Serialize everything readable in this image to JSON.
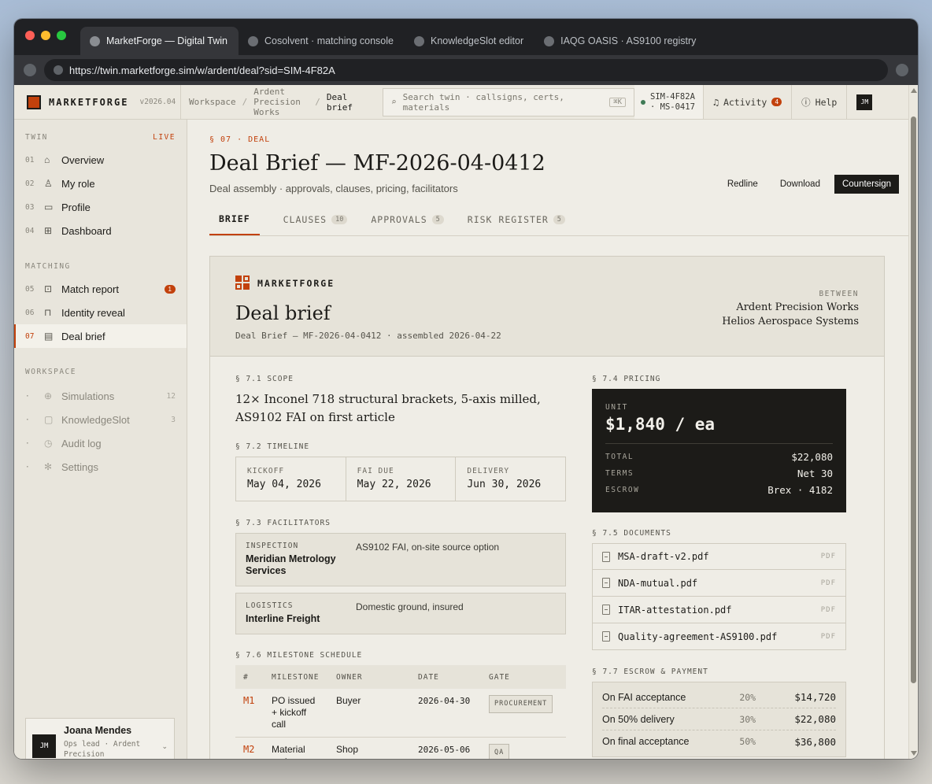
{
  "browser": {
    "tabs": [
      {
        "title": "MarketForge — Digital Twin"
      },
      {
        "title": "Cosolvent · matching console"
      },
      {
        "title": "KnowledgeSlot editor"
      },
      {
        "title": "IAQG OASIS · AS9100 registry"
      }
    ],
    "url": "https://twin.marketforge.sim/w/ardent/deal?sid=SIM-4F82A"
  },
  "header": {
    "brand": "MARKETFORGE",
    "version": "v2026.04",
    "breadcrumb": [
      "Workspace",
      "Ardent Precision Works",
      "Deal brief"
    ],
    "search_placeholder": "Search twin · callsigns, certs, materials",
    "search_shortcut": "⌘K",
    "sim_id": "SIM-4F82A · MS-0417",
    "activity_label": "Activity",
    "activity_count": "4",
    "help_label": "Help",
    "user_initials": "JM"
  },
  "sidebar": {
    "twin_section": "TWIN",
    "live_label": "LIVE",
    "twin_items": [
      {
        "num": "01",
        "label": "Overview",
        "icon": "home-icon"
      },
      {
        "num": "02",
        "label": "My role",
        "icon": "user-icon"
      },
      {
        "num": "03",
        "label": "Profile",
        "icon": "id-card-icon"
      },
      {
        "num": "04",
        "label": "Dashboard",
        "icon": "grid-icon"
      }
    ],
    "matching_section": "MATCHING",
    "matching_items": [
      {
        "num": "05",
        "label": "Match report",
        "icon": "ticket-icon",
        "badge": "1"
      },
      {
        "num": "06",
        "label": "Identity reveal",
        "icon": "lock-icon"
      },
      {
        "num": "07",
        "label": "Deal brief",
        "icon": "document-icon"
      }
    ],
    "workspace_section": "WORKSPACE",
    "workspace_items": [
      {
        "num": "·",
        "label": "Simulations",
        "icon": "globe-icon",
        "count": "12"
      },
      {
        "num": "·",
        "label": "KnowledgeSlot",
        "icon": "book-icon",
        "count": "3"
      },
      {
        "num": "·",
        "label": "Audit log",
        "icon": "clock-icon"
      },
      {
        "num": "·",
        "label": "Settings",
        "icon": "gear-icon"
      }
    ],
    "user": {
      "name": "Joana Mendes",
      "role": "Ops lead · Ardent Precision",
      "initials": "JM"
    }
  },
  "page": {
    "kicker": "§ 07 · DEAL",
    "title": "Deal Brief — MF-2026-04-0412",
    "subtitle": "Deal assembly · approvals, clauses, pricing, facilitators",
    "actions": {
      "redline": "Redline",
      "download": "Download",
      "countersign": "Countersign"
    },
    "tabs": [
      {
        "label": "BRIEF"
      },
      {
        "label": "CLAUSES",
        "count": "10"
      },
      {
        "label": "APPROVALS",
        "count": "5"
      },
      {
        "label": "RISK REGISTER",
        "count": "5"
      }
    ]
  },
  "brief": {
    "brand": "MARKETFORGE",
    "title": "Deal brief",
    "meta": "Deal Brief — MF-2026-04-0412 · assembled 2026-04-22",
    "between_label": "BETWEEN",
    "party_a": "Ardent Precision Works",
    "party_b": "Helios Aerospace Systems",
    "scope_heading": "§ 7.1 SCOPE",
    "scope": "12× Inconel 718 structural brackets, 5-axis milled, AS9102 FAI on first article",
    "timeline_heading": "§ 7.2 TIMELINE",
    "timeline": [
      {
        "label": "KICKOFF",
        "value": "May 04, 2026"
      },
      {
        "label": "FAI DUE",
        "value": "May 22, 2026"
      },
      {
        "label": "DELIVERY",
        "value": "Jun 30, 2026"
      }
    ],
    "facilitators_heading": "§ 7.3 FACILITATORS",
    "facilitators": [
      {
        "role": "INSPECTION",
        "name": "Meridian Metrology Services",
        "desc": "AS9102 FAI, on-site source option"
      },
      {
        "role": "LOGISTICS",
        "name": "Interline Freight",
        "desc": "Domestic ground, insured"
      }
    ],
    "milestones_heading": "§ 7.6 MILESTONE SCHEDULE",
    "milestone_columns": [
      "#",
      "MILESTONE",
      "OWNER",
      "DATE",
      "GATE"
    ],
    "milestones": [
      {
        "id": "M1",
        "name": "PO issued + kickoff call",
        "owner": "Buyer",
        "date": "2026-04-30",
        "gate": "PROCUREMENT"
      },
      {
        "id": "M2",
        "name": "Material cert",
        "owner": "Shop",
        "date": "2026-05-06",
        "gate": "QA"
      }
    ],
    "pricing_heading": "§ 7.4 PRICING",
    "pricing": {
      "unit_label": "UNIT",
      "unit_value": "$1,840 / ea",
      "total_label": "TOTAL",
      "total_value": "$22,080",
      "terms_label": "TERMS",
      "terms_value": "Net 30",
      "escrow_label": "ESCROW",
      "escrow_value": "Brex · 4182"
    },
    "documents_heading": "§ 7.5 DOCUMENTS",
    "documents": [
      {
        "name": "MSA-draft-v2.pdf",
        "type": "PDF"
      },
      {
        "name": "NDA-mutual.pdf",
        "type": "PDF"
      },
      {
        "name": "ITAR-attestation.pdf",
        "type": "PDF"
      },
      {
        "name": "Quality-agreement-AS9100.pdf",
        "type": "PDF"
      }
    ],
    "escrow_heading": "§ 7.7 ESCROW & PAYMENT",
    "escrow": [
      {
        "desc": "On FAI acceptance",
        "pct": "20%",
        "amount": "$14,720"
      },
      {
        "desc": "On 50% delivery",
        "pct": "30%",
        "amount": "$22,080"
      },
      {
        "desc": "On final acceptance",
        "pct": "50%",
        "amount": "$36,800"
      }
    ]
  }
}
